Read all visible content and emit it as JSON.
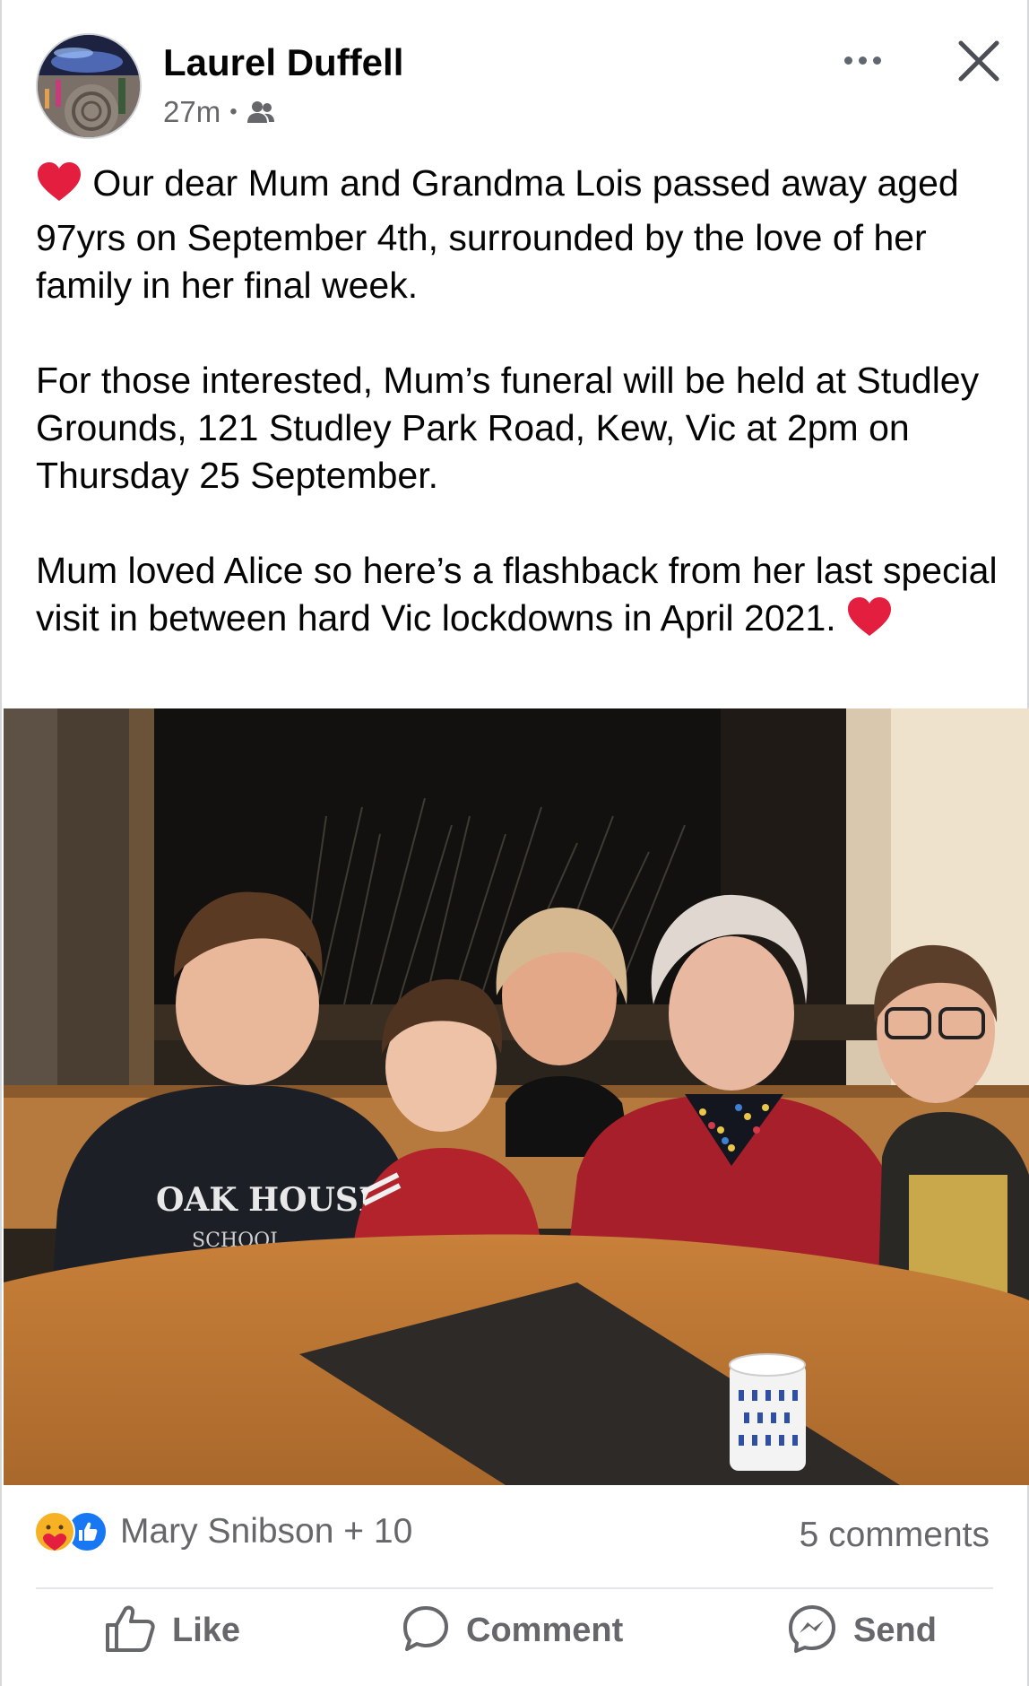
{
  "post": {
    "author": "Laurel Duffell",
    "time": "27m",
    "audience_icon": "friends-icon",
    "paragraphs": [
      {
        "text": "Our dear Mum and Grandma Lois passed away aged 97yrs on September 4th, surrounded by the love of her family in her final week."
      },
      {
        "text": "For those interested, Mum’s funeral will be held at Studley Grounds, 121 Studley Park Road, Kew, Vic at 2pm on Thursday 25 September."
      },
      {
        "text": "Mum loved Alice so here’s a flashback from her last special visit in between hard Vic lockdowns in April 2021."
      }
    ],
    "photo_sweatshirt_text": "OAK HOUSE",
    "photo_sweatshirt_sub": "SCHOOL"
  },
  "reactions": {
    "names": "Mary Snibson + 10",
    "icons": [
      "care-reaction-icon",
      "like-reaction-icon"
    ],
    "comments": "5 comments"
  },
  "actions": {
    "like": "Like",
    "comment": "Comment",
    "send": "Send"
  },
  "colors": {
    "text": "#050505",
    "secondary": "#65676b",
    "like_blue": "#1877f2",
    "heart_red": "#e41e3f"
  }
}
